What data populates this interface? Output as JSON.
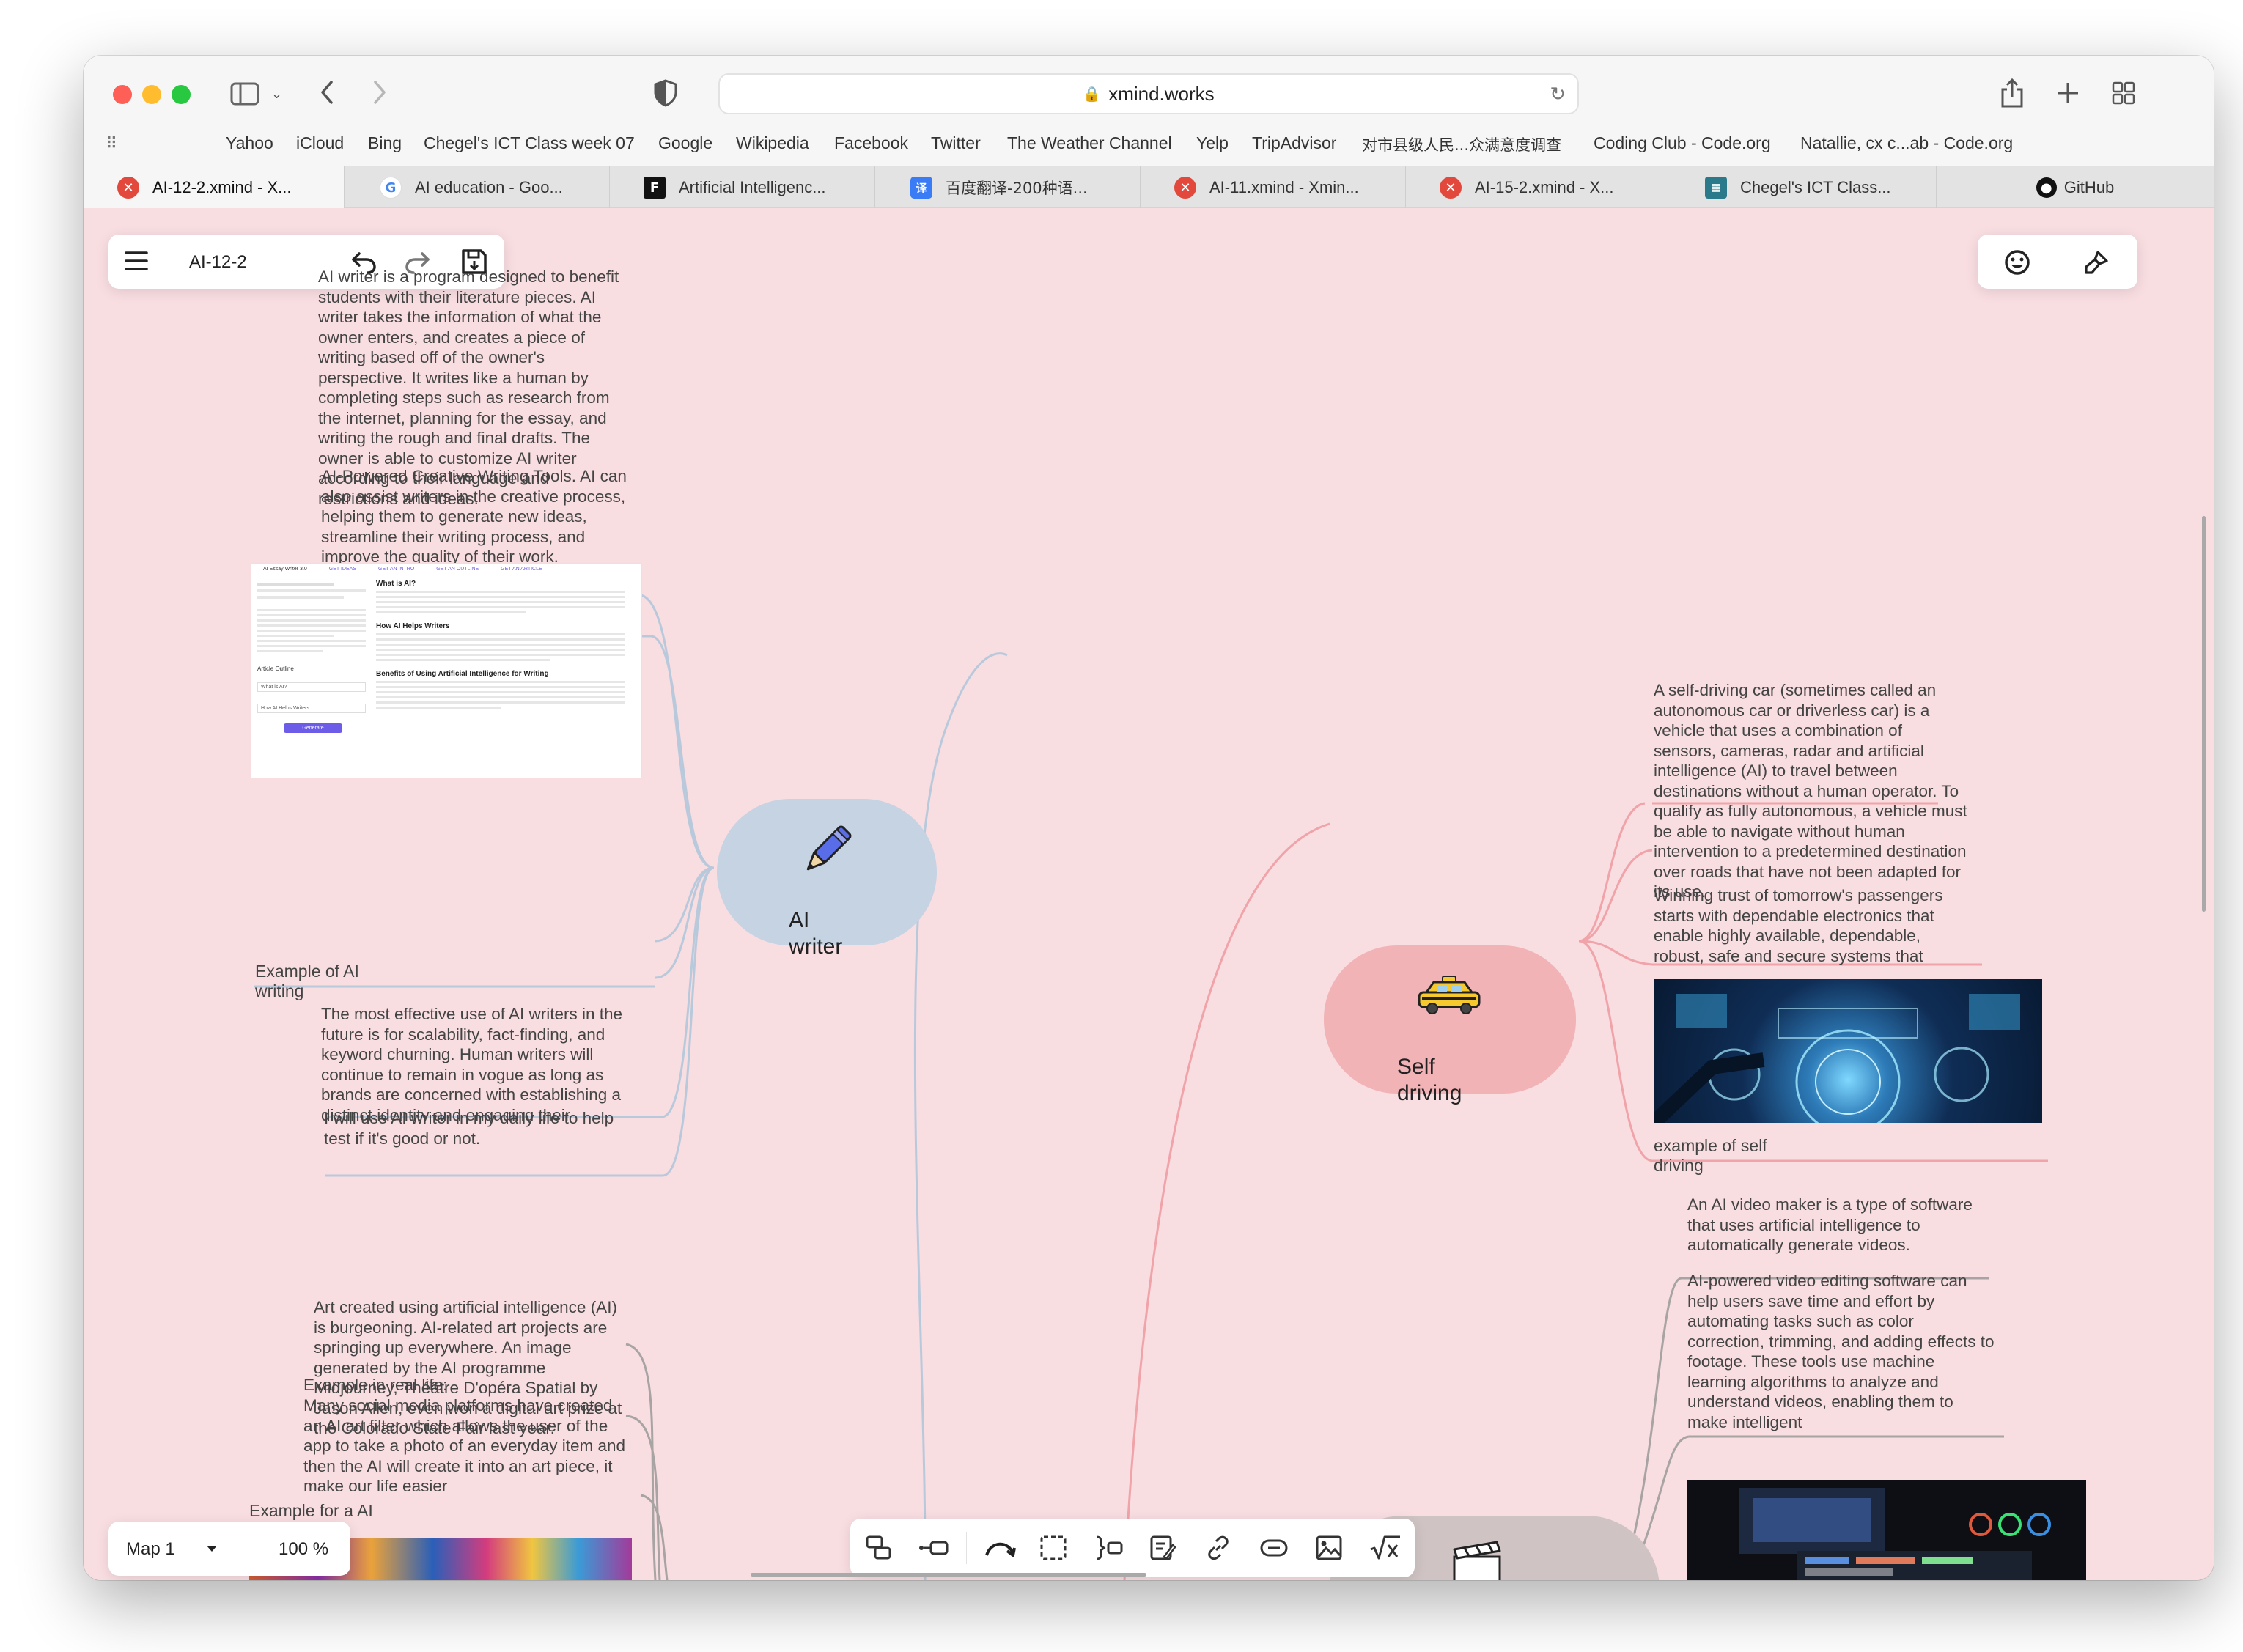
{
  "browser": {
    "url": "xmind.works",
    "bookmarks": [
      "Yahoo",
      "iCloud",
      "Bing",
      "Chegel's ICT Class week 07",
      "Google",
      "Wikipedia",
      "Facebook",
      "Twitter",
      "The Weather Channel",
      "Yelp",
      "TripAdvisor",
      "对市县级人民...众满意度调查",
      "Coding Club - Code.org",
      "Natallie, cx c...ab - Code.org"
    ],
    "tabs": [
      {
        "label": "AI-12-2.xmind - X...",
        "icon": "xmind-icon",
        "color": "#e2483c"
      },
      {
        "label": "AI education - Goo...",
        "icon": "google-icon",
        "color": "#4285f4"
      },
      {
        "label": "Artificial Intelligenc...",
        "icon": "forbes-icon",
        "color": "#111111"
      },
      {
        "label": "百度翻译-200种语...",
        "icon": "baidu-translate-icon",
        "color": "#3a7cf6"
      },
      {
        "label": "AI-11.xmind - Xmin...",
        "icon": "xmind-icon",
        "color": "#e2483c"
      },
      {
        "label": "AI-15-2.xmind - X...",
        "icon": "xmind-icon",
        "color": "#e2483c"
      },
      {
        "label": "Chegel's ICT Class...",
        "icon": "code-icon",
        "color": "#2b7a8c"
      },
      {
        "label": "GitHub",
        "icon": "github-icon",
        "color": "#111111"
      }
    ]
  },
  "app": {
    "file_name": "AI-12-2",
    "map_name": "Map 1",
    "zoom": "100 %"
  },
  "colors": {
    "canvas": "#f8dde1",
    "ai_writer_topic": "#c5d3e3",
    "ai_writer_branch": "#b9c9dc",
    "self_driving_topic": "#f2b3b6",
    "self_driving_branch": "#f0a3a8",
    "video_topic": "#cfc3c3",
    "art_branch": "#a8a4a4"
  },
  "topics": {
    "ai_writer": {
      "label": "AI writer",
      "icon": "pen-icon"
    },
    "self_driving": {
      "label": "Self driving",
      "icon": "taxi-icon"
    }
  },
  "notes": {
    "writer_1": "AI writer is a program designed to benefit students with their literature pieces. AI writer takes the information of what the owner enters, and creates a piece of writing based off of the owner's perspective. It writes like a human by completing steps such as research from the internet, planning for the essay, and writing the rough and final drafts. The owner is able to customize AI writer according to their language and restrictions and ideas.",
    "writer_2": "AI-Powered Creative Writing Tools. AI can also assist writers in the creative process, helping them to generate new ideas, streamline their writing process, and improve the quality of their work.",
    "writer_caption": "Example of AI writing",
    "writer_3": "The most effective use of AI writers in the future is for scalability, fact-finding, and keyword churning. Human writers will continue to remain in vogue as long as brands are concerned with establishing a distinct identity and engaging their audiences.",
    "writer_4": "I will use AI writer in my daily life  to help test if it's good or not.",
    "art_1": "Art created using artificial intelligence (AI) is burgeoning. AI-related art projects are springing up everywhere. An image generated by the AI programme Midjourney, Théâtre D'opéra Spatial by Jason Allen, even won a digital art prize at the Colorado State Fair last year.",
    "art_2": "Example in real life:",
    "art_3": "Many social media platforms have created an AI art filter which allows the user of the app to take a photo of an everyday item and then the AI will create it into an art piece, it make our life easier",
    "art_caption": "Example for a AI painting",
    "drive_1": "A self-driving car (sometimes called an autonomous car or driverless car) is a vehicle that uses a combination of sensors, cameras, radar and artificial intelligence (AI) to travel between destinations without a human operator. To qualify as fully autonomous, a vehicle must be able to navigate without human intervention to a predetermined destination over roads that have not been adapted for its use.",
    "drive_2": "Winning trust of tomorrow's passengers starts with dependable electronics that enable highly available, dependable, robust, safe and secure systems that operate in all",
    "drive_caption": "example of self driving",
    "video_1": "An AI video maker is a type of software that uses artificial intelligence to automatically generate videos.",
    "video_2": "AI-powered video editing software can help users save time and effort by automating tasks such as color correction, trimming, and adding effects to footage. These tools use machine learning algorithms to analyze and understand videos, enabling them to make intelligent"
  },
  "screenshot_writer": {
    "tabs": [
      "AI Essay Writer 3.0",
      "GET IDEAS",
      "GET AN INTRO",
      "GET AN OUTLINE",
      "GET AN ARTICLE"
    ],
    "heading_1": "What is AI?",
    "heading_2": "How AI Helps Writers",
    "heading_3": "Benefits of Using Artificial Intelligence for Writing",
    "outline_label": "Article Outline",
    "outline_1": "What is AI?",
    "outline_2": "How AI Helps Writers",
    "button": "Generate"
  },
  "bottom_toolbar": [
    "topic-icon",
    "subtopic-icon",
    "relationship-icon",
    "boundary-icon",
    "summary-icon",
    "note-icon",
    "link-icon",
    "label-icon",
    "image-icon",
    "equation-icon"
  ]
}
